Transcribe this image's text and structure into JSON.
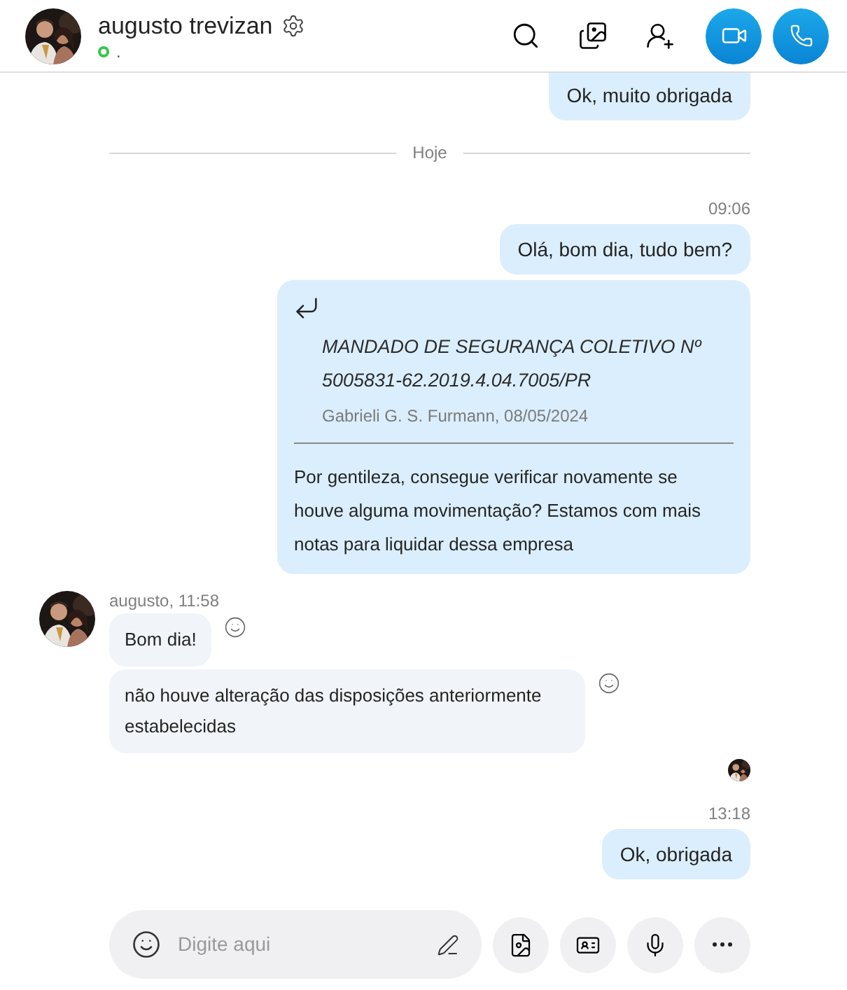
{
  "header": {
    "name": "augusto trevizan",
    "online": true,
    "status_text": "."
  },
  "messages": [
    {
      "kind": "sent",
      "partial": true,
      "text": "Ok, muito obrigada"
    },
    {
      "kind": "divider",
      "text": "Hoje"
    },
    {
      "kind": "timestamp",
      "text": "09:06"
    },
    {
      "kind": "sent",
      "partial": false,
      "text": "Olá, bom dia, tudo bem?"
    },
    {
      "kind": "quote",
      "quote_title": "MANDADO DE SEGURANÇA COLETIVO Nº 5005831-62.2019.4.04.7005/PR",
      "quote_source": "Gabrieli G. S. Furmann, 08/05/2024",
      "text": "Por gentileza, consegue verificar novamente se houve alguma movimentação? Estamos com mais notas para liquidar dessa empresa"
    },
    {
      "kind": "received",
      "sender": "augusto, 11:58",
      "bubbles": [
        {
          "text": "Bom dia!"
        },
        {
          "text": "não houve alteração das disposições anteriormente estabelecidas"
        }
      ]
    },
    {
      "kind": "seen"
    },
    {
      "kind": "timestamp",
      "text": "13:18"
    },
    {
      "kind": "sent",
      "partial": false,
      "text": "Ok, obrigada"
    }
  ],
  "composer": {
    "placeholder": "Digite aqui"
  }
}
